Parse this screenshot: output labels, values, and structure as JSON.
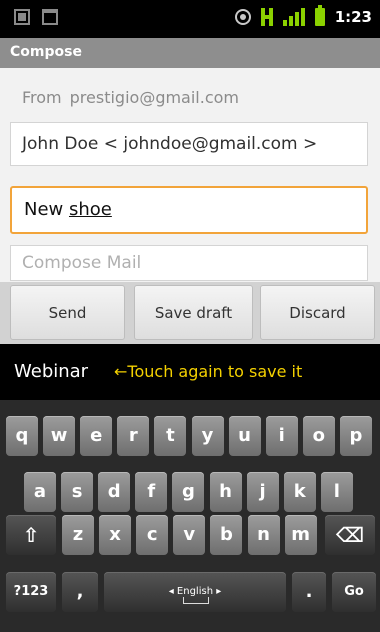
{
  "status_bar": {
    "time": "1:23"
  },
  "header": {
    "title": "Compose"
  },
  "compose": {
    "from_label": "From",
    "from_value": "prestigio@gmail.com",
    "to_value": "John Doe < johndoe@gmail.com >",
    "subject_prefix": "New ",
    "subject_underlined": "shoe",
    "body_placeholder": "Compose Mail"
  },
  "actions": {
    "send": "Send",
    "save_draft": "Save draft",
    "discard": "Discard"
  },
  "suggestion": {
    "word": "Webinar",
    "hint": "←Touch again to save it"
  },
  "keyboard": {
    "row1": [
      "q",
      "w",
      "e",
      "r",
      "t",
      "y",
      "u",
      "i",
      "o",
      "p"
    ],
    "row2": [
      "a",
      "s",
      "d",
      "f",
      "g",
      "h",
      "j",
      "k",
      "l"
    ],
    "row3": [
      "z",
      "x",
      "c",
      "v",
      "b",
      "n",
      "m"
    ],
    "symbols_key": "?123",
    "comma_key": ",",
    "space_key": "◂ English ▸",
    "period_key": ".",
    "go_key": "Go",
    "shift_key": "⇧",
    "delete_key": "⌫"
  }
}
